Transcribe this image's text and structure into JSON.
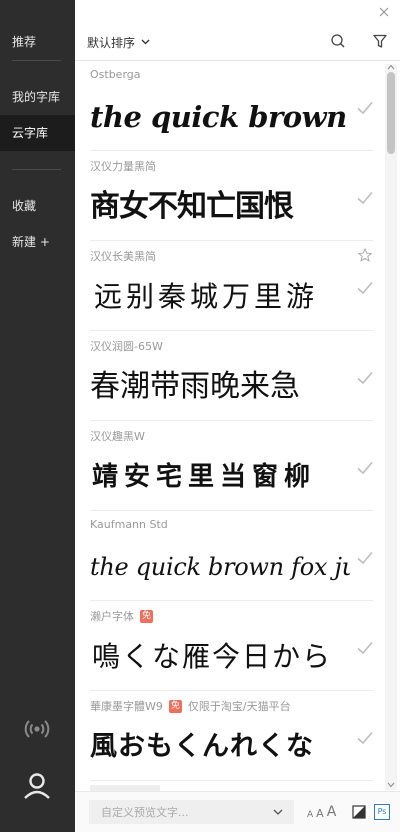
{
  "sidebar": {
    "recommend": "推荐",
    "my_library": "我的字库",
    "cloud_library": "云字库",
    "favorites": "收藏",
    "new": "新建 +"
  },
  "toolbar": {
    "sort_label": "默认排序"
  },
  "fonts": [
    {
      "name": "Ostberga",
      "preview": "the quick brown fox ju",
      "installed": true
    },
    {
      "name": "汉仪力量黑简",
      "preview": "商女不知亡国恨",
      "installed": true
    },
    {
      "name": "汉仪长美黑简",
      "preview": "远别秦城万里游",
      "installed": true,
      "favorite": false
    },
    {
      "name": "汉仪润圆-65W",
      "preview": "春潮带雨晚来急",
      "installed": true
    },
    {
      "name": "汉仪趣黑W",
      "preview": "靖安宅里当窗柳",
      "installed": true
    },
    {
      "name": "Kaufmann Std",
      "preview": "the quick brown fox jum",
      "installed": true
    },
    {
      "name": "濑户字体",
      "badge": "免",
      "preview": "鳴くな雁今日から",
      "installed": true
    },
    {
      "name": "華康墨字體W9",
      "badge": "免",
      "note": "仅限于淘宝/天猫平台",
      "preview": "風おもくんれくな",
      "installed": true
    }
  ],
  "footer": {
    "preview_placeholder": "自定义预览文字...",
    "size_small": "A",
    "size_medium": "A",
    "size_large": "A",
    "ps_label": "Ps"
  },
  "colors": {
    "sidebar_bg": "#2d2d2d",
    "sidebar_active": "#1c1c1c",
    "badge": "#f06e5c",
    "ps_blue": "#2a7fd4"
  }
}
